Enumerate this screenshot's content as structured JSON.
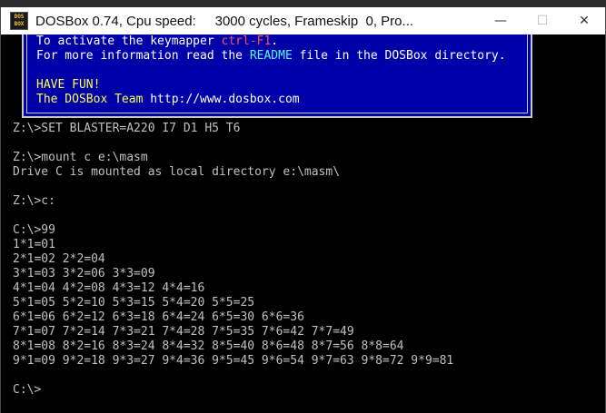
{
  "window": {
    "title": "DOSBox 0.74, Cpu speed:     3000 cycles, Frameskip  0, Pro...",
    "icon_label": "DOS BOX",
    "buttons": {
      "minimize": "—",
      "maximize": "☐",
      "close": "✕"
    }
  },
  "banner": {
    "line1_a": "To activate the keymapper ",
    "line1_b": "ctrl-F1",
    "line1_c": ".",
    "line2_a": "For more information read the ",
    "line2_b": "README",
    "line2_c": " file in the DOSBox directory.",
    "line3": "HAVE FUN!",
    "line4_a": "The DOSBox Team ",
    "line4_b": "http://www.dosbox.com"
  },
  "console_lines": [
    "Z:\\>SET BLASTER=A220 I7 D1 H5 T6",
    "",
    "Z:\\>mount c e:\\masm",
    "Drive C is mounted as local directory e:\\masm\\",
    "",
    "Z:\\>c:",
    "",
    "C:\\>99",
    "1*1=01",
    "2*1=02 2*2=04",
    "3*1=03 3*2=06 3*3=09",
    "4*1=04 4*2=08 4*3=12 4*4=16",
    "5*1=05 5*2=10 5*3=15 5*4=20 5*5=25",
    "6*1=06 6*2=12 6*3=18 6*4=24 6*5=30 6*6=36",
    "7*1=07 7*2=14 7*3=21 7*4=28 7*5=35 7*6=42 7*7=49",
    "8*1=08 8*2=16 8*3=24 8*4=32 8*5=40 8*6=48 8*7=56 8*8=64",
    "9*1=09 9*2=18 9*3=27 9*4=36 9*5=45 9*6=54 9*7=63 9*8=72 9*9=81",
    "",
    "C:\\>"
  ]
}
